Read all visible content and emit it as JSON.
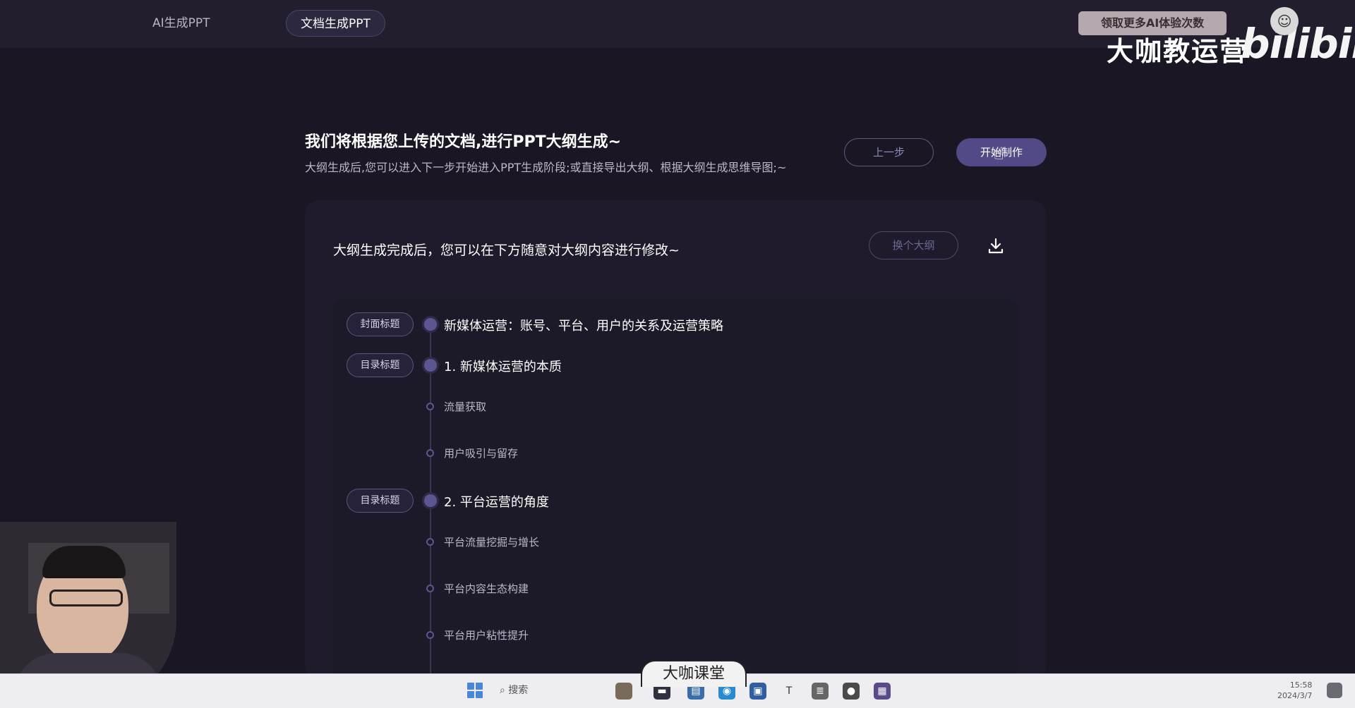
{
  "nav": {
    "tabs": [
      {
        "label": "AI生成PPT",
        "active": false
      },
      {
        "label": "文档生成PPT",
        "active": true
      }
    ]
  },
  "watermark": {
    "pill_text": "领取更多AI体验次数",
    "brand_text": "大咖教运营",
    "bili_text": "bilibili"
  },
  "header": {
    "title": "我们将根据您上传的文档,进行PPT大纲生成~",
    "subtitle": "大纲生成后,您可以进入下一步开始进入PPT生成阶段;或直接导出大纲、根据大纲生成思维导图;~",
    "prev_label": "上一步",
    "start_label": "开始制作"
  },
  "card": {
    "title": "大纲生成完成后，您可以在下方随意对大纲内容进行修改~",
    "swap_label": "换个大纲",
    "download_icon": "download-icon"
  },
  "outline": {
    "items": [
      {
        "tag": "封面标题",
        "text": "新媒体运营：账号、平台、用户的关系及运营策略",
        "level": 1
      },
      {
        "tag": "目录标题",
        "text": "1. 新媒体运营的本质",
        "level": 1
      },
      {
        "tag": "",
        "text": "流量获取",
        "level": 2
      },
      {
        "tag": "",
        "text": "用户吸引与留存",
        "level": 2
      },
      {
        "tag": "目录标题",
        "text": "2. 平台运营的角度",
        "level": 1
      },
      {
        "tag": "",
        "text": "平台流量挖掘与增长",
        "level": 2
      },
      {
        "tag": "",
        "text": "平台内容生态构建",
        "level": 2
      },
      {
        "tag": "",
        "text": "平台用户粘性提升",
        "level": 2
      }
    ]
  },
  "taskbar": {
    "search_label": "搜索",
    "time": "15:58",
    "date": "2024/3/7"
  },
  "logo_bottom": "大咖课堂",
  "colors": {
    "background": "#1a1624",
    "accent": "#524a86",
    "timeline_dot": "#5c5690"
  }
}
